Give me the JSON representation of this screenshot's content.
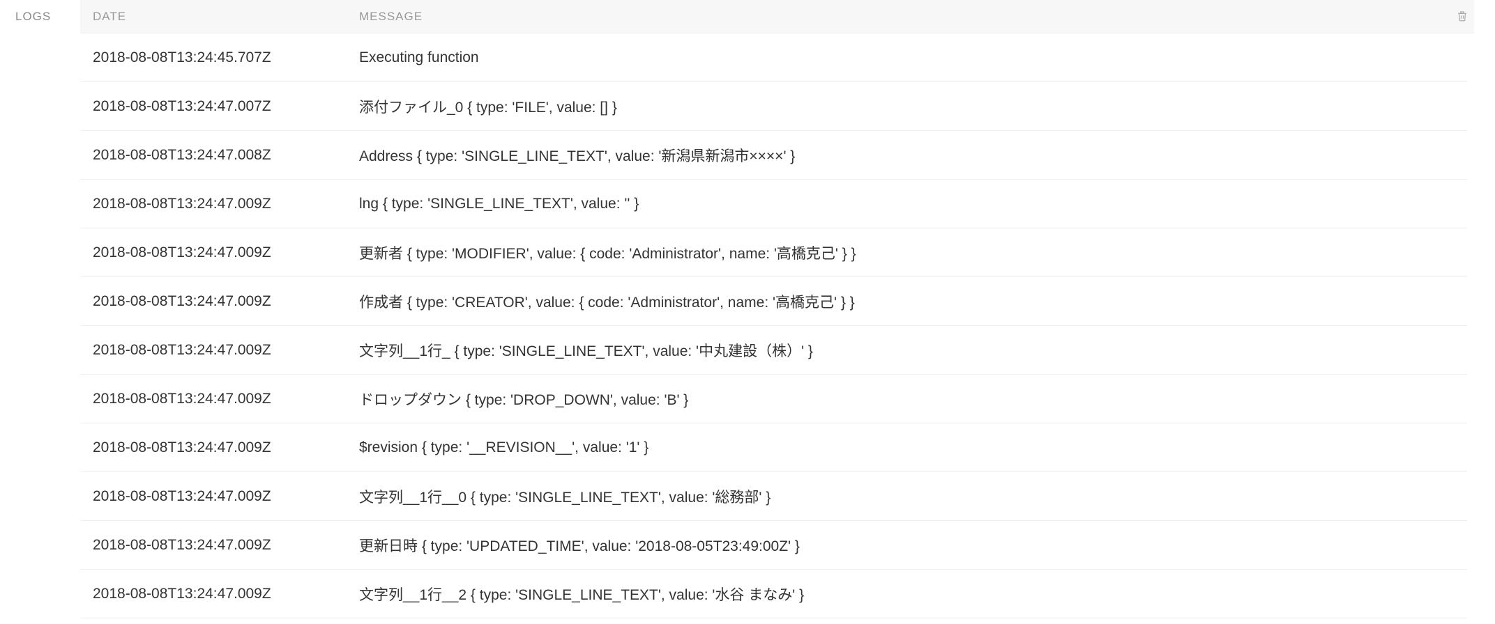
{
  "sidebar": {
    "label": "LOGS"
  },
  "header": {
    "date": "DATE",
    "message": "MESSAGE"
  },
  "rows": [
    {
      "date": "2018-08-08T13:24:45.707Z",
      "message": "Executing function"
    },
    {
      "date": "2018-08-08T13:24:47.007Z",
      "message": "添付ファイル_0 { type: 'FILE', value: [] }"
    },
    {
      "date": "2018-08-08T13:24:47.008Z",
      "message": "Address { type: 'SINGLE_LINE_TEXT', value: '新潟県新潟市××××' }"
    },
    {
      "date": "2018-08-08T13:24:47.009Z",
      "message": "lng { type: 'SINGLE_LINE_TEXT', value: '' }"
    },
    {
      "date": "2018-08-08T13:24:47.009Z",
      "message": "更新者 { type: 'MODIFIER', value: { code: 'Administrator', name: '高橋克己' } }"
    },
    {
      "date": "2018-08-08T13:24:47.009Z",
      "message": "作成者 { type: 'CREATOR', value: { code: 'Administrator', name: '高橋克己' } }"
    },
    {
      "date": "2018-08-08T13:24:47.009Z",
      "message": "文字列__1行_ { type: 'SINGLE_LINE_TEXT', value: '中丸建設（株）' }"
    },
    {
      "date": "2018-08-08T13:24:47.009Z",
      "message": "ドロップダウン { type: 'DROP_DOWN', value: 'B' }"
    },
    {
      "date": "2018-08-08T13:24:47.009Z",
      "message": "$revision { type: '__REVISION__', value: '1' }"
    },
    {
      "date": "2018-08-08T13:24:47.009Z",
      "message": "文字列__1行__0 { type: 'SINGLE_LINE_TEXT', value: '総務部' }"
    },
    {
      "date": "2018-08-08T13:24:47.009Z",
      "message": "更新日時 { type: 'UPDATED_TIME', value: '2018-08-05T23:49:00Z' }"
    },
    {
      "date": "2018-08-08T13:24:47.009Z",
      "message": "文字列__1行__2 { type: 'SINGLE_LINE_TEXT', value: '水谷 まなみ' }"
    }
  ]
}
